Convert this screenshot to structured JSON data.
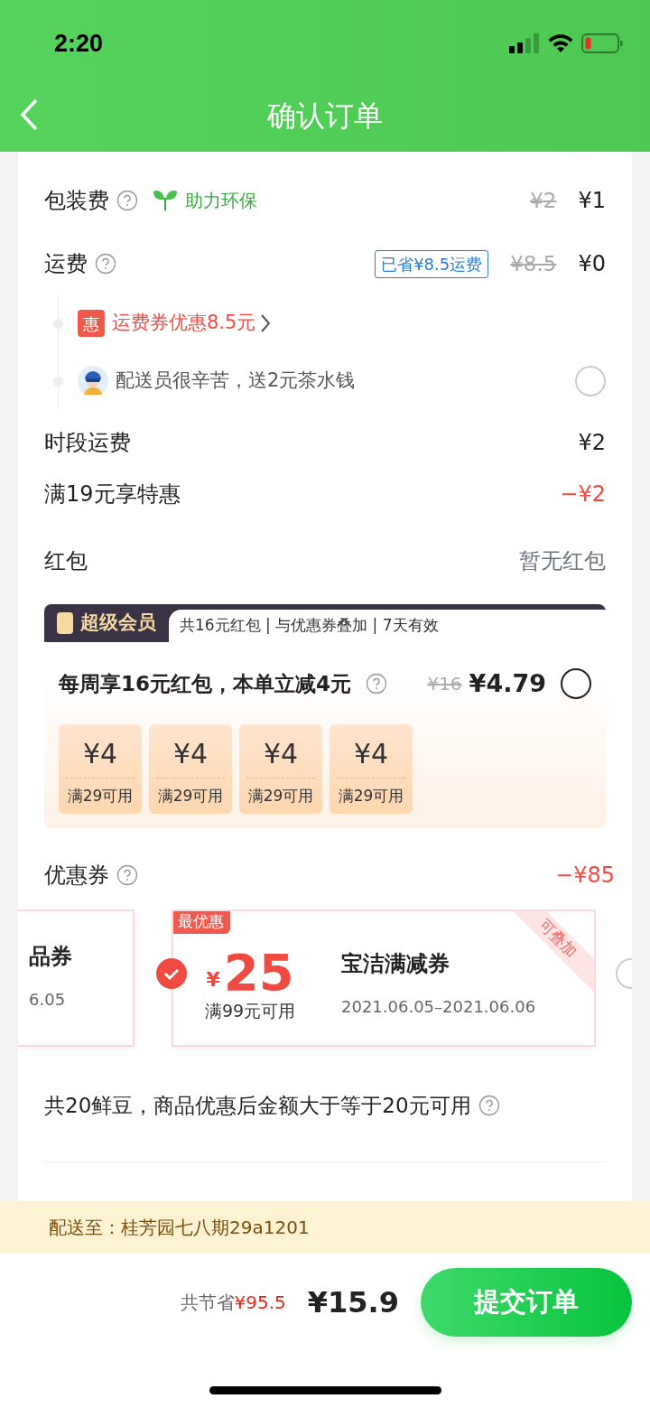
{
  "status_bar": {
    "time": "2:20"
  },
  "header": {
    "title": "确认订单"
  },
  "fee_rows": [
    {
      "label": "包装费",
      "help": true,
      "eco_tag": "助力环保",
      "original": "¥2",
      "price": "¥1"
    },
    {
      "label": "运费",
      "help": true,
      "saved_badge": "已省¥8.5运费",
      "original": "¥8.5",
      "price": "¥0"
    }
  ],
  "sub_items": [
    {
      "kind": "coupon",
      "icon_text": "惠",
      "text": "运费券优惠8.5元"
    },
    {
      "kind": "tip",
      "text": "配送员很辛苦，送2元茶水钱",
      "checked": false
    }
  ],
  "extra_rows": [
    {
      "label": "时段运费",
      "price": "¥2",
      "kind": "normal"
    },
    {
      "label": "满19元享特惠",
      "price": "−¥2",
      "kind": "discount"
    },
    {
      "label": "红包",
      "price": "暂无红包",
      "kind": "muted"
    }
  ],
  "vip_card": {
    "badge": "超级会员",
    "perks": "共16元红包 | 与优惠券叠加 | 7天有效",
    "offer": "每周享16元红包，本单立减**4元**",
    "original": "¥16",
    "price": "¥4.79",
    "selected": false,
    "packets": [
      {
        "amount": "¥4",
        "condition": "满29可用"
      },
      {
        "amount": "¥4",
        "condition": "满29可用"
      },
      {
        "amount": "¥4",
        "condition": "满29可用"
      },
      {
        "amount": "¥4",
        "condition": "满29可用"
      }
    ]
  },
  "coupons": {
    "label": "优惠券",
    "total": "−¥85",
    "items": [
      {
        "kind": "partial-left",
        "title": "品券",
        "dates": "6.05"
      },
      {
        "kind": "full",
        "tag": "最优惠",
        "currency": "¥",
        "amount": "25",
        "condition": "满99元可用",
        "title": "宝洁满减券",
        "dates": "2021.06.05–2021.06.06",
        "ribbon": "可叠加",
        "selected": true
      },
      {
        "kind": "partial-right",
        "selected": false
      }
    ]
  },
  "beans": {
    "text": "共20鲜豆，商品优惠后金额大于等于20元可用"
  },
  "address_bar": {
    "text": "配送至：桂芳园七八期29a1201"
  },
  "footer": {
    "saved_label": "共节省",
    "saved_amount": "¥95.5",
    "total": "¥15.9",
    "submit": "提交订单"
  }
}
